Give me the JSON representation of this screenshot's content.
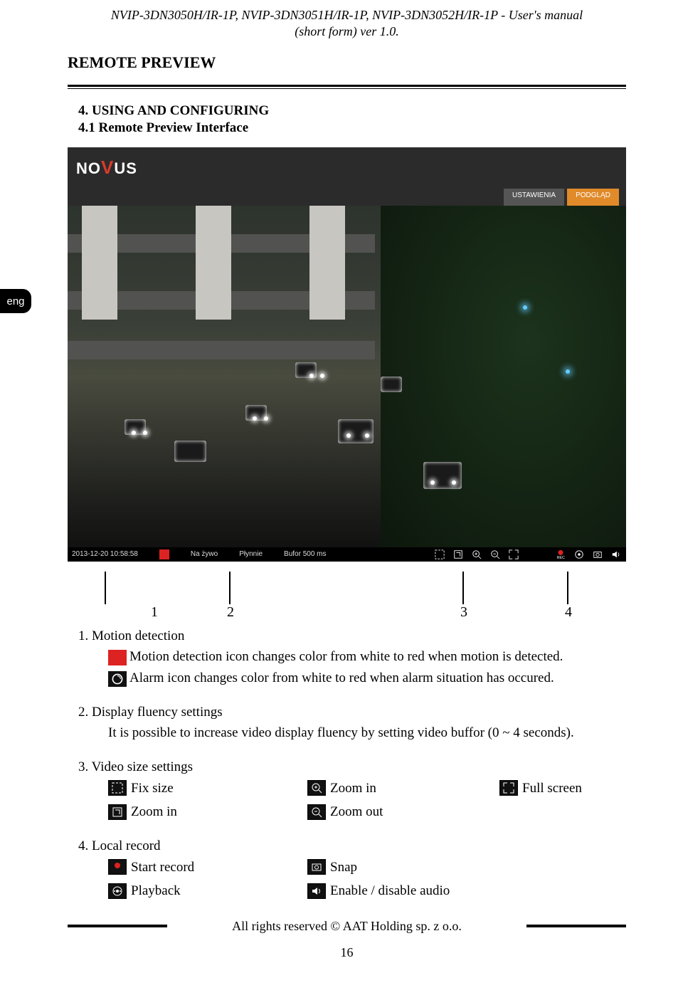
{
  "running_head_line1": "NVIP-3DN3050H/IR-1P, NVIP-3DN3051H/IR-1P, NVIP-3DN3052H/IR-1P - User's manual",
  "running_head_line2": "(short form) ver 1.0.",
  "section_title": "REMOTE PREVIEW",
  "chapter_heading": "4. USING AND CONFIGURING",
  "chapter_sub": "4.1 Remote Preview Interface",
  "lang_tab": "eng",
  "screenshot": {
    "logo_left": "NO",
    "logo_right": "US",
    "tabs": {
      "settings": "USTAWIENIA",
      "preview": "PODGLĄD"
    },
    "statusbar": {
      "timestamp": "2013-12-20 10:58:58",
      "mode": "Na żywo",
      "stream": "Płynnie",
      "buffer": "Bufor 500 ms"
    }
  },
  "pointers": {
    "p1": "1",
    "p2": "2",
    "p3": "3",
    "p4": "4"
  },
  "item1": {
    "title": "1. Motion detection",
    "line_a": "Motion detection icon changes color from white to red when motion is detected.",
    "line_b": "Alarm icon changes color from white to red when alarm situation has occured."
  },
  "item2": {
    "title": "2. Display fluency settings",
    "line_a": "It is possible to increase video display fluency by setting video buffor (0 ~ 4 seconds)."
  },
  "item3": {
    "title": "3. Video size settings",
    "fix_size": "Fix size",
    "zoom_in_a": "Zoom in",
    "zoom_in_b": "Zoom in",
    "zoom_out": "Zoom out",
    "full_screen": "Full screen"
  },
  "item4": {
    "title": "4. Local record",
    "start_record": "Start record",
    "playback": "Playback",
    "snap": "Snap",
    "audio": "Enable / disable audio"
  },
  "footer": "All rights reserved © AAT Holding sp. z o.o.",
  "page_number": "16"
}
